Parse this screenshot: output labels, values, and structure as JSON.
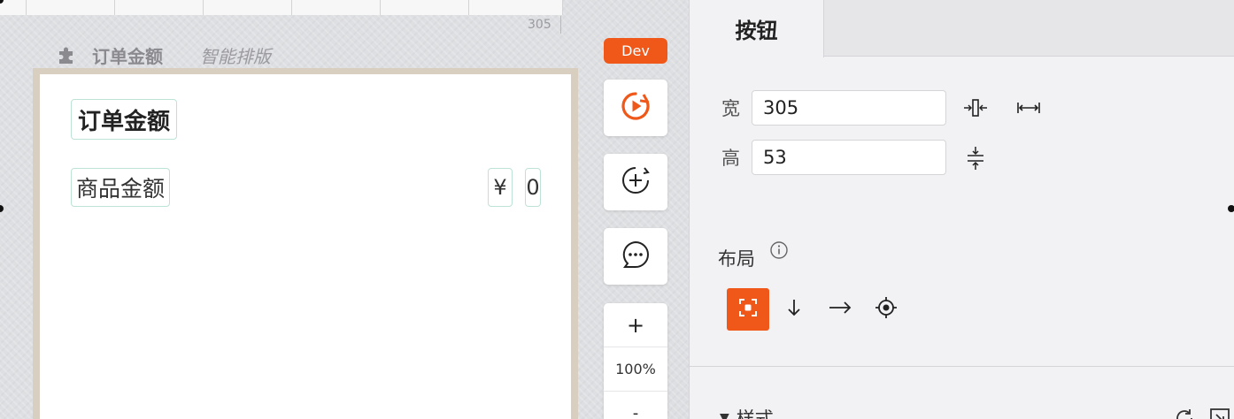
{
  "canvas": {
    "ruler_width": "305",
    "page_name": "订单金额",
    "smart_layout_label": "智能排版",
    "dev_badge": "Dev",
    "content": {
      "title": "订单金额",
      "product_label": "商品金额",
      "currency": "¥",
      "amount": "0"
    },
    "zoom": {
      "zoom_in": "+",
      "level": "100%",
      "zoom_out": "-"
    },
    "icons": [
      "puzzle-icon",
      "play-icon",
      "add-circle-icon",
      "comment-icon"
    ]
  },
  "panel": {
    "tab_label": "按钮",
    "width_label": "宽",
    "width_value": "305",
    "height_label": "高",
    "height_value": "53",
    "layout_label": "布局",
    "layout_options": [
      "free",
      "vertical",
      "horizontal",
      "center"
    ],
    "style_label": "样式",
    "style_arrow": "▼"
  },
  "colors": {
    "accent": "#f0581a",
    "frame": "#d8cfc0",
    "outline": "#bde3d4"
  }
}
